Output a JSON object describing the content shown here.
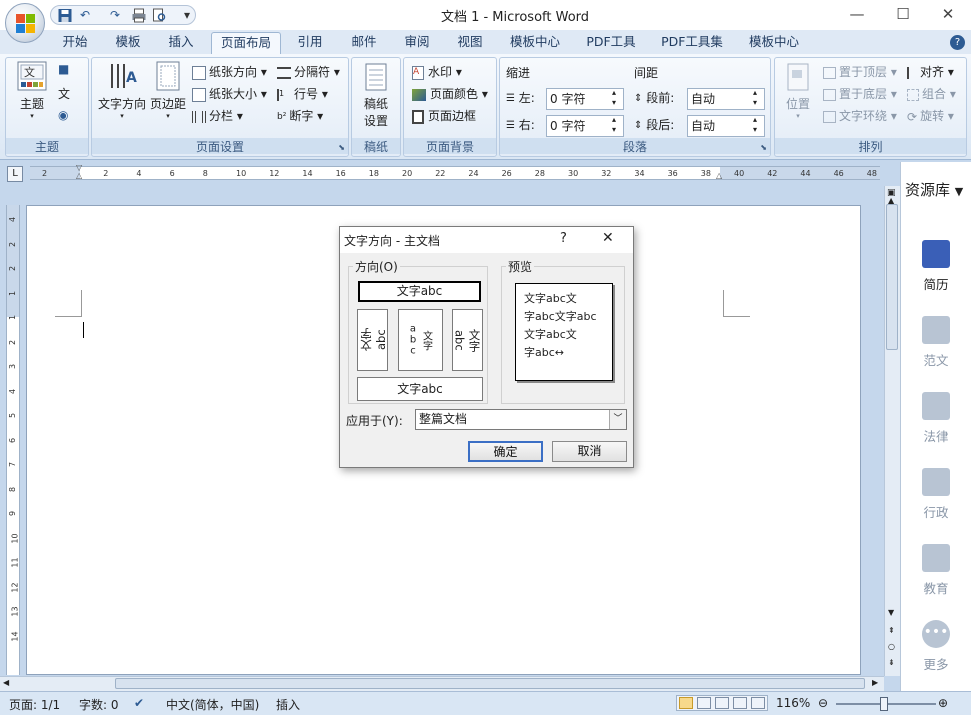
{
  "window": {
    "title": "文档 1 - Microsoft Word",
    "minimize": "—",
    "maximize": "☐",
    "close": "✕"
  },
  "qat": {
    "save_icon": "floppy-disk",
    "undo": "↶",
    "redo": "↷",
    "more": "▾"
  },
  "tabs": [
    {
      "label": "开始"
    },
    {
      "label": "模板"
    },
    {
      "label": "插入"
    },
    {
      "label": "页面布局",
      "active": true
    },
    {
      "label": "引用"
    },
    {
      "label": "邮件"
    },
    {
      "label": "审阅"
    },
    {
      "label": "视图"
    },
    {
      "label": "模板中心"
    },
    {
      "label": "PDF工具"
    },
    {
      "label": "PDF工具集"
    },
    {
      "label": "模板中心"
    }
  ],
  "ribbon": {
    "themes": {
      "label": "主题",
      "btn": "主题",
      "colors": "■",
      "fonts": "文",
      "effects": "◉"
    },
    "page_setup": {
      "label": "页面设置",
      "text_direction": "文字方向",
      "margins": "页边距",
      "orientation": "纸张方向",
      "size": "纸张大小",
      "columns": "分栏",
      "breaks": "分隔符",
      "line_numbers": "行号",
      "hyphenation": "断字"
    },
    "draft": {
      "label": "稿纸",
      "btn_line1": "稿纸",
      "btn_line2": "设置"
    },
    "background": {
      "label": "页面背景",
      "watermark": "水印",
      "page_color": "页面颜色",
      "page_borders": "页面边框"
    },
    "paragraph": {
      "label": "段落",
      "indent": "缩进",
      "left_label": "左:",
      "left_value": "0 字符",
      "right_label": "右:",
      "right_value": "0 字符",
      "spacing": "间距",
      "before_label": "段前:",
      "before_value": "自动",
      "after_label": "段后:",
      "after_value": "自动"
    },
    "arrange": {
      "label": "排列",
      "position": "位置",
      "bring_front": "置于顶层",
      "send_back": "置于底层",
      "text_wrap": "文字环绕",
      "align": "对齐",
      "group": "组合",
      "rotate": "旋转"
    }
  },
  "ruler": {
    "marks": [
      "2",
      "2",
      "4",
      "6",
      "8",
      "10",
      "12",
      "14",
      "16",
      "18",
      "20",
      "22",
      "24",
      "26",
      "28",
      "30",
      "32",
      "34",
      "36",
      "38",
      "40",
      "42",
      "44",
      "46",
      "48"
    ],
    "vmarks": [
      "4",
      "2",
      "2",
      "1",
      "1",
      "2",
      "3",
      "4",
      "5",
      "6",
      "7",
      "8",
      "9",
      "10",
      "11",
      "12",
      "13",
      "14"
    ]
  },
  "dialog": {
    "title": "文字方向 - 主文档",
    "help": "?",
    "close": "✕",
    "orientation_group": "方向(O)",
    "preview_group": "预览",
    "opt_horizontal": "文字abc",
    "opt_v1": "文字abc",
    "opt_v2": "文字abc",
    "opt_v3": "文字abc",
    "opt_bottom": "文字abc",
    "preview_lines": [
      "文字abc文",
      "字abc文字abc",
      "文字abc文",
      "字abc↔"
    ],
    "apply_label": "应用于(Y):",
    "apply_value": "整篇文档",
    "ok": "确定",
    "cancel": "取消"
  },
  "side_panel": {
    "title": "资源库",
    "items": [
      {
        "label": "简历",
        "color": "#3a5fb7"
      },
      {
        "label": "范文",
        "color": "#b8c4d3"
      },
      {
        "label": "法律",
        "color": "#b8c4d3"
      },
      {
        "label": "行政",
        "color": "#b8c4d3"
      },
      {
        "label": "教育",
        "color": "#b8c4d3"
      },
      {
        "label": "更多",
        "color": "#b8c4d3"
      }
    ]
  },
  "status": {
    "page": "页面: 1/1",
    "words": "字数: 0",
    "language": "中文(简体，中国)",
    "mode": "插入",
    "zoom": "116%"
  }
}
